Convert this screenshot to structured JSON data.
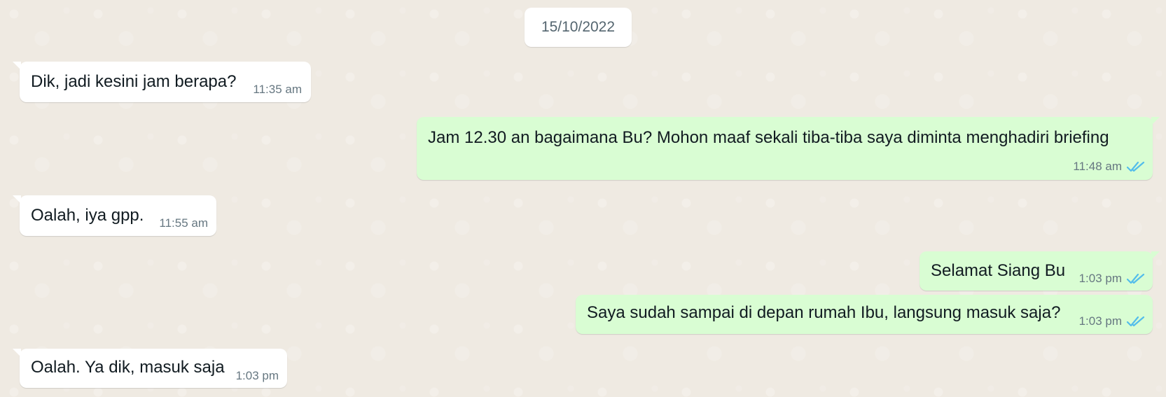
{
  "date": "15/10/2022",
  "colors": {
    "wallpaper": "#efeae2",
    "incoming_bubble": "#ffffff",
    "outgoing_bubble": "#d9fdd3",
    "read_ticks": "#53bdeb",
    "timestamp": "#667781"
  },
  "messages": [
    {
      "direction": "incoming",
      "text": "Dik, jadi kesini jam berapa?",
      "time": "11:35 am"
    },
    {
      "direction": "outgoing",
      "text": "Jam 12.30 an bagaimana Bu? Mohon maaf sekali tiba-tiba saya diminta menghadiri briefing",
      "time": "11:48 am",
      "status_icon": "double-check-read-icon"
    },
    {
      "direction": "incoming",
      "text": "Oalah, iya gpp.",
      "time": "11:55 am"
    },
    {
      "direction": "outgoing",
      "text": "Selamat Siang Bu",
      "time": "1:03 pm",
      "status_icon": "double-check-read-icon"
    },
    {
      "direction": "outgoing",
      "text": "Saya sudah sampai di depan rumah Ibu, langsung masuk saja?",
      "time": "1:03 pm",
      "status_icon": "double-check-read-icon"
    },
    {
      "direction": "incoming",
      "text": "Oalah. Ya dik, masuk saja",
      "time": "1:03 pm"
    }
  ]
}
